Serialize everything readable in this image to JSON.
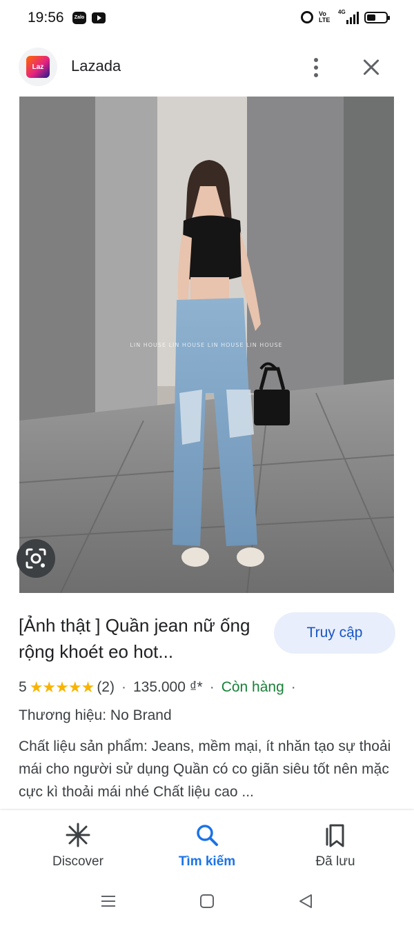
{
  "status_bar": {
    "time": "19:56",
    "notifications": [
      "zalo-icon",
      "youtube-icon"
    ],
    "zalo_text": "Zalo",
    "network": "4G",
    "volte_text": "Vo LTE",
    "right_icons": [
      "alarm-icon",
      "volte-icon",
      "signal-icon",
      "battery-icon"
    ]
  },
  "header": {
    "logo_text": "Laz",
    "title": "Lazada",
    "more_icon": "more-vert-icon",
    "close_icon": "close-icon"
  },
  "product": {
    "image_watermark": "LIN HOUSE LIN HOUSE LIN HOUSE LIN HOUSE",
    "title": "[Ảnh thật ] Quần jean nữ ống rộng khoét eo hot...",
    "visit_button": "Truy cập",
    "rating_value": "5",
    "stars": "★★★★★",
    "rating_count": "(2)",
    "separator": "·",
    "price": "135.000 ₫*",
    "stock_status": "Còn hàng",
    "brand": "Thương hiệu: No Brand",
    "description": "Chất liệu sản phẩm: Jeans, mềm mại, ít nhăn tạo sự thoải mái cho người sử dụng Quần có co giãn siêu tốt nên mặc cực kì thoải mái nhé Chất liệu cao ..."
  },
  "bottom_nav": {
    "items": [
      {
        "label": "Discover",
        "icon": "asterisk-icon",
        "active": false
      },
      {
        "label": "Tìm kiếm",
        "icon": "search-icon",
        "active": true
      },
      {
        "label": "Đã lưu",
        "icon": "bookmarks-icon",
        "active": false
      }
    ]
  },
  "colors": {
    "accent": "#1a73e8",
    "visit_button_bg": "#e8eefb",
    "visit_button_text": "#1a56c4",
    "stars": "#f7b400",
    "stock": "#188038"
  }
}
